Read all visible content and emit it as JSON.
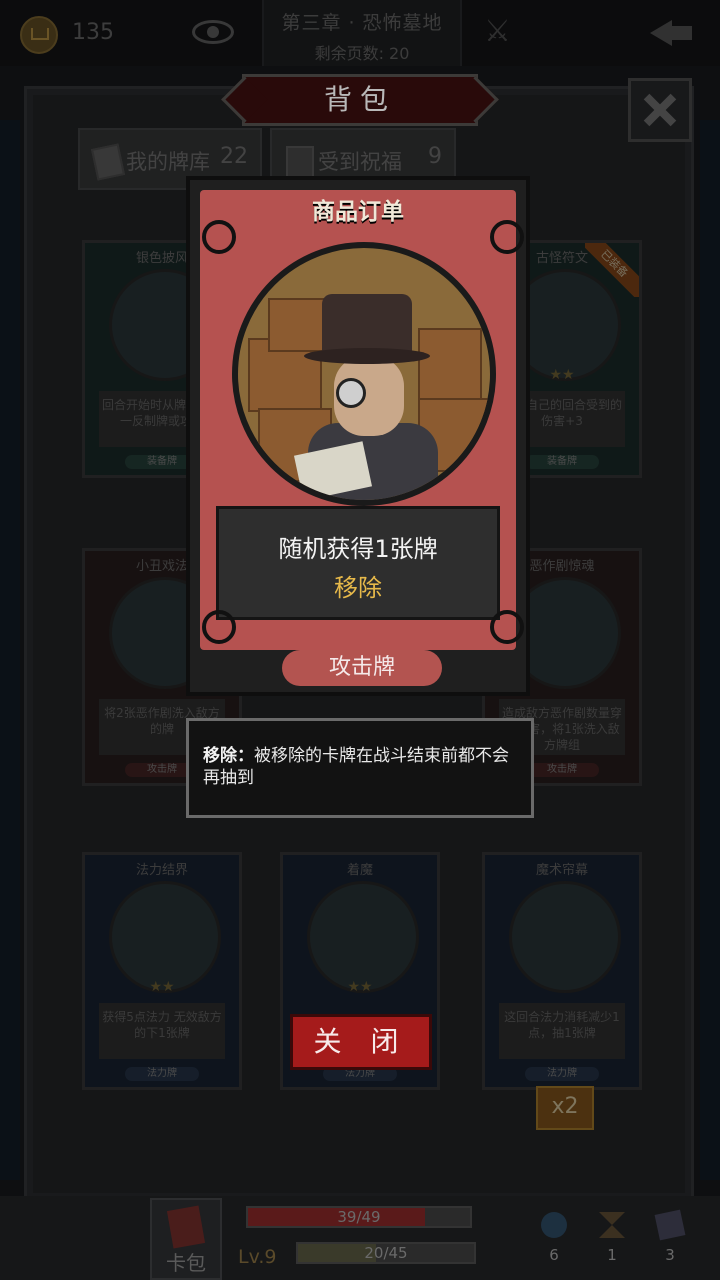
{
  "topbar": {
    "gold": "135",
    "chapter": "第三章 · 恐怖墓地",
    "pages_left": "剩余页数: 20",
    "icons": [
      "crown-coin-icon",
      "eye-icon",
      "map-icon",
      "back-arrow-icon"
    ]
  },
  "panel": {
    "title": "背包",
    "tabs": [
      {
        "label": "我的牌库",
        "count": "22"
      },
      {
        "label": "受到祝福",
        "count": "9"
      }
    ],
    "cards": [
      {
        "title": "银色披风",
        "desc": "回合开始时从牌组使用一反制牌或攻击",
        "type": "装备牌",
        "stars": ""
      },
      {
        "title": "古怪符文",
        "desc": "在他自己的回合受到的伤害+3",
        "type": "装备牌",
        "stars": "★★",
        "badge": "已装备"
      },
      {
        "title": "小丑戏法",
        "desc": "将2张恶作剧洗入敌方的牌",
        "type": "攻击牌",
        "stars": ""
      },
      {
        "title": "恶作剧惊魂",
        "desc": "造成敌方恶作剧数量穿刺伤害，将1张洗入敌方牌组",
        "type": "攻击牌",
        "stars": ""
      },
      {
        "title": "法力结界",
        "desc": "获得5点法力 无效敌方的下1张牌",
        "type": "法力牌",
        "stars": "★★"
      },
      {
        "title": "着魔",
        "desc": "",
        "type": "法力牌",
        "stars": "★★"
      },
      {
        "title": "魔术帘幕",
        "desc": "这回合法力消耗减少1点，抽1张牌",
        "type": "法力牌",
        "stars": ""
      }
    ],
    "multiplier": "x2"
  },
  "detail": {
    "title": "商品订单",
    "effect_line1": "随机获得1张牌",
    "effect_line2": "移除",
    "type": "攻击牌"
  },
  "tooltip": {
    "term": "移除：",
    "text": "被移除的卡牌在战斗结束前都不会再抽到"
  },
  "close_button": "关 闭",
  "bottombar": {
    "deck_label": "卡包",
    "hp_text": "39/49",
    "hp_fraction": 0.796,
    "level": "Lv.9",
    "xp_text": "20/45",
    "xp_fraction": 0.444,
    "resources": [
      {
        "icon": "potion-icon",
        "value": "6"
      },
      {
        "icon": "hourglass-icon",
        "value": "1"
      },
      {
        "icon": "cards-icon",
        "value": "3"
      }
    ]
  }
}
